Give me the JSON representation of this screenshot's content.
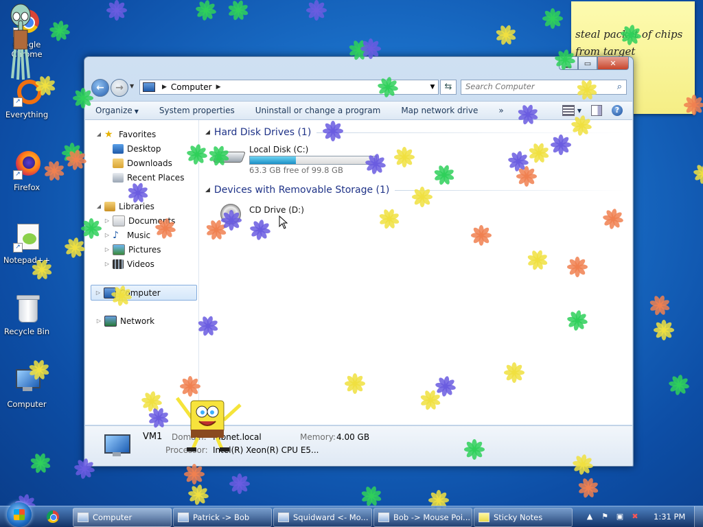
{
  "desktop": {
    "icons": [
      {
        "label": "Google Chrome",
        "line1": "Google",
        "line2": "Chrome",
        "icon": "chrome-icon"
      },
      {
        "label": "Everything",
        "icon": "everything-icon"
      },
      {
        "label": "Firefox",
        "icon": "firefox-icon"
      },
      {
        "label": "Notepad++",
        "icon": "notepadpp-icon"
      },
      {
        "label": "Recycle Bin",
        "icon": "recycle-bin-icon"
      },
      {
        "label": "Computer",
        "icon": "computer-icon"
      }
    ]
  },
  "sticky_note": {
    "text_line1": "steal packet of chips",
    "text_line2": "from target"
  },
  "explorer": {
    "address": {
      "location": "Computer"
    },
    "search": {
      "placeholder": "Search Computer"
    },
    "toolbar": {
      "organize": "Organize",
      "system_properties": "System properties",
      "uninstall": "Uninstall or change a program",
      "map_drive": "Map network drive",
      "more": "»"
    },
    "nav": {
      "favorites": "Favorites",
      "desktop": "Desktop",
      "downloads": "Downloads",
      "recent_places": "Recent Places",
      "libraries": "Libraries",
      "documents": "Documents",
      "music": "Music",
      "pictures": "Pictures",
      "videos": "Videos",
      "computer": "Computer",
      "network": "Network"
    },
    "groups": {
      "hdd": "Hard Disk Drives (1)",
      "removable": "Devices with Removable Storage (1)"
    },
    "drives": {
      "c": {
        "name": "Local Disk (C:)",
        "free": "63.3 GB free of 99.8 GB",
        "used_fraction": 0.366
      },
      "d": {
        "name": "CD Drive (D:)"
      }
    },
    "details": {
      "name": "VM1",
      "domain_label": "Domain:",
      "domain_value": "fabnet.local",
      "memory_label": "Memory:",
      "memory_value": "4.00 GB",
      "processor_label": "Processor:",
      "processor_value": "Intel(R) Xeon(R) CPU E5..."
    }
  },
  "taskbar": {
    "tasks": [
      "Computer",
      "Patrick -> Bob",
      "Squidward <- Mo...",
      "Bob -> Mouse Poi...",
      "Sticky Notes"
    ],
    "clock": "1:31 PM"
  },
  "colors": {
    "accent": "#1e3287",
    "drive_fill": "#1b8fc6",
    "sticky": "#f7f08c",
    "flower_blue": "#6a5ce0",
    "flower_green": "#2fd05a",
    "flower_yellow": "#f0e040",
    "flower_orange": "#f08050"
  }
}
